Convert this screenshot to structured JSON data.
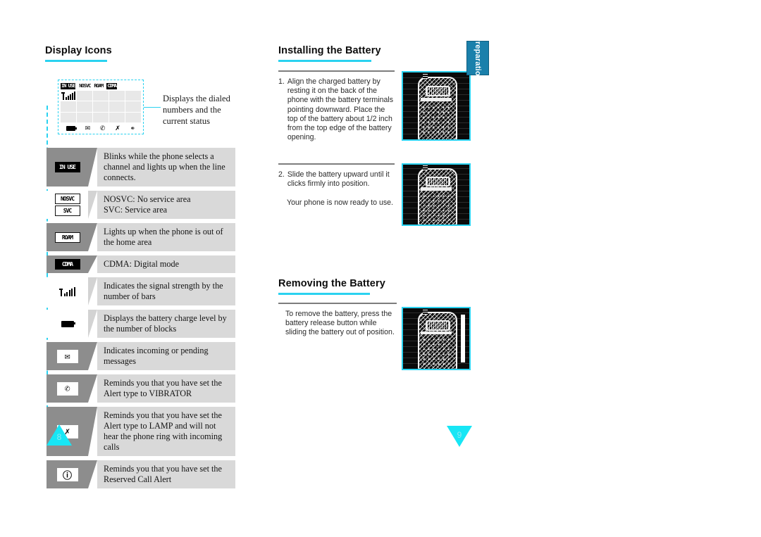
{
  "document": {
    "type": "phone-user-manual-spread",
    "accent_color": "#2ad2f0",
    "tab_color": "#1a80ab"
  },
  "left_page": {
    "title": "Display Icons",
    "page_number": "8",
    "display_mock": {
      "top_indicators": [
        {
          "label": "IN USE",
          "style": "inverted"
        },
        {
          "label": "NOSVC",
          "style": "plain"
        },
        {
          "label": "ROAM",
          "style": "plain"
        },
        {
          "label": "CDMA",
          "style": "inverted"
        }
      ],
      "signal_bars": 5,
      "bottom_icons": [
        "battery-icon",
        "envelope-icon",
        "vibrator-icon",
        "lamp-icon",
        "clock-icon"
      ]
    },
    "callout": "Displays the dialed numbers and the current status",
    "icon_rows": [
      {
        "icon_name": "in-use-icon",
        "icon_label": "IN USE",
        "icon_style": "inverted",
        "description": "Blinks while the phone selects a channel and lights up when the line connects."
      },
      {
        "icon_name": "service-area-icon",
        "icon_label": "NOSVC",
        "icon_label_2": "SVC",
        "icon_style": "stack",
        "description": "NOSVC: No service area\nSVC: Service area"
      },
      {
        "icon_name": "roam-icon",
        "icon_label": "ROAM",
        "icon_style": "plain",
        "description": "Lights up when the phone is out of the home area"
      },
      {
        "icon_name": "cdma-icon",
        "icon_label": "CDMA",
        "icon_style": "inverted",
        "description": "CDMA: Digital mode"
      },
      {
        "icon_name": "signal-strength-icon",
        "icon_label": "",
        "icon_style": "signal",
        "description": "Indicates the signal strength by the number of bars"
      },
      {
        "icon_name": "battery-icon",
        "icon_label": "",
        "icon_style": "battery",
        "description": "Displays the battery charge level by the number of blocks"
      },
      {
        "icon_name": "message-envelope-icon",
        "icon_label": "✉",
        "icon_style": "glyph",
        "description": "Indicates incoming or pending messages"
      },
      {
        "icon_name": "vibrator-alert-icon",
        "icon_label": "✆",
        "icon_style": "glyph",
        "description": "Reminds you that you have set the Alert type to VIBRATOR"
      },
      {
        "icon_name": "lamp-alert-icon",
        "icon_label": "✗",
        "icon_style": "glyph",
        "description": "Reminds you that you have set the Alert type to LAMP and will not hear the phone ring with incoming calls"
      },
      {
        "icon_name": "reserved-call-alert-icon",
        "icon_label": "ⓘ",
        "icon_style": "glyph",
        "description": "Reminds you that you have set the Reserved Call Alert"
      }
    ]
  },
  "right_page": {
    "page_number": "9",
    "side_tab": "Preparation",
    "sections": [
      {
        "title": "Installing the Battery",
        "steps": [
          {
            "number": "1.",
            "text": "Align the charged battery by resting it on the back of the phone with the battery terminals pointing downward. Place the top of the battery about 1/2 inch from the top edge of the battery opening.",
            "image_name": "phone-back-with-battery-photo"
          },
          {
            "number": "2.",
            "text": "Slide the battery  upward until it clicks firmly into position.",
            "note": "Your phone is now ready to use.",
            "image_name": "phone-battery-slide-photo"
          }
        ]
      },
      {
        "title": "Removing the Battery",
        "steps": [
          {
            "number": "",
            "text": "To remove the battery, press the battery release button while sliding the battery out of position.",
            "image_name": "phone-battery-release-photo"
          }
        ]
      }
    ]
  }
}
